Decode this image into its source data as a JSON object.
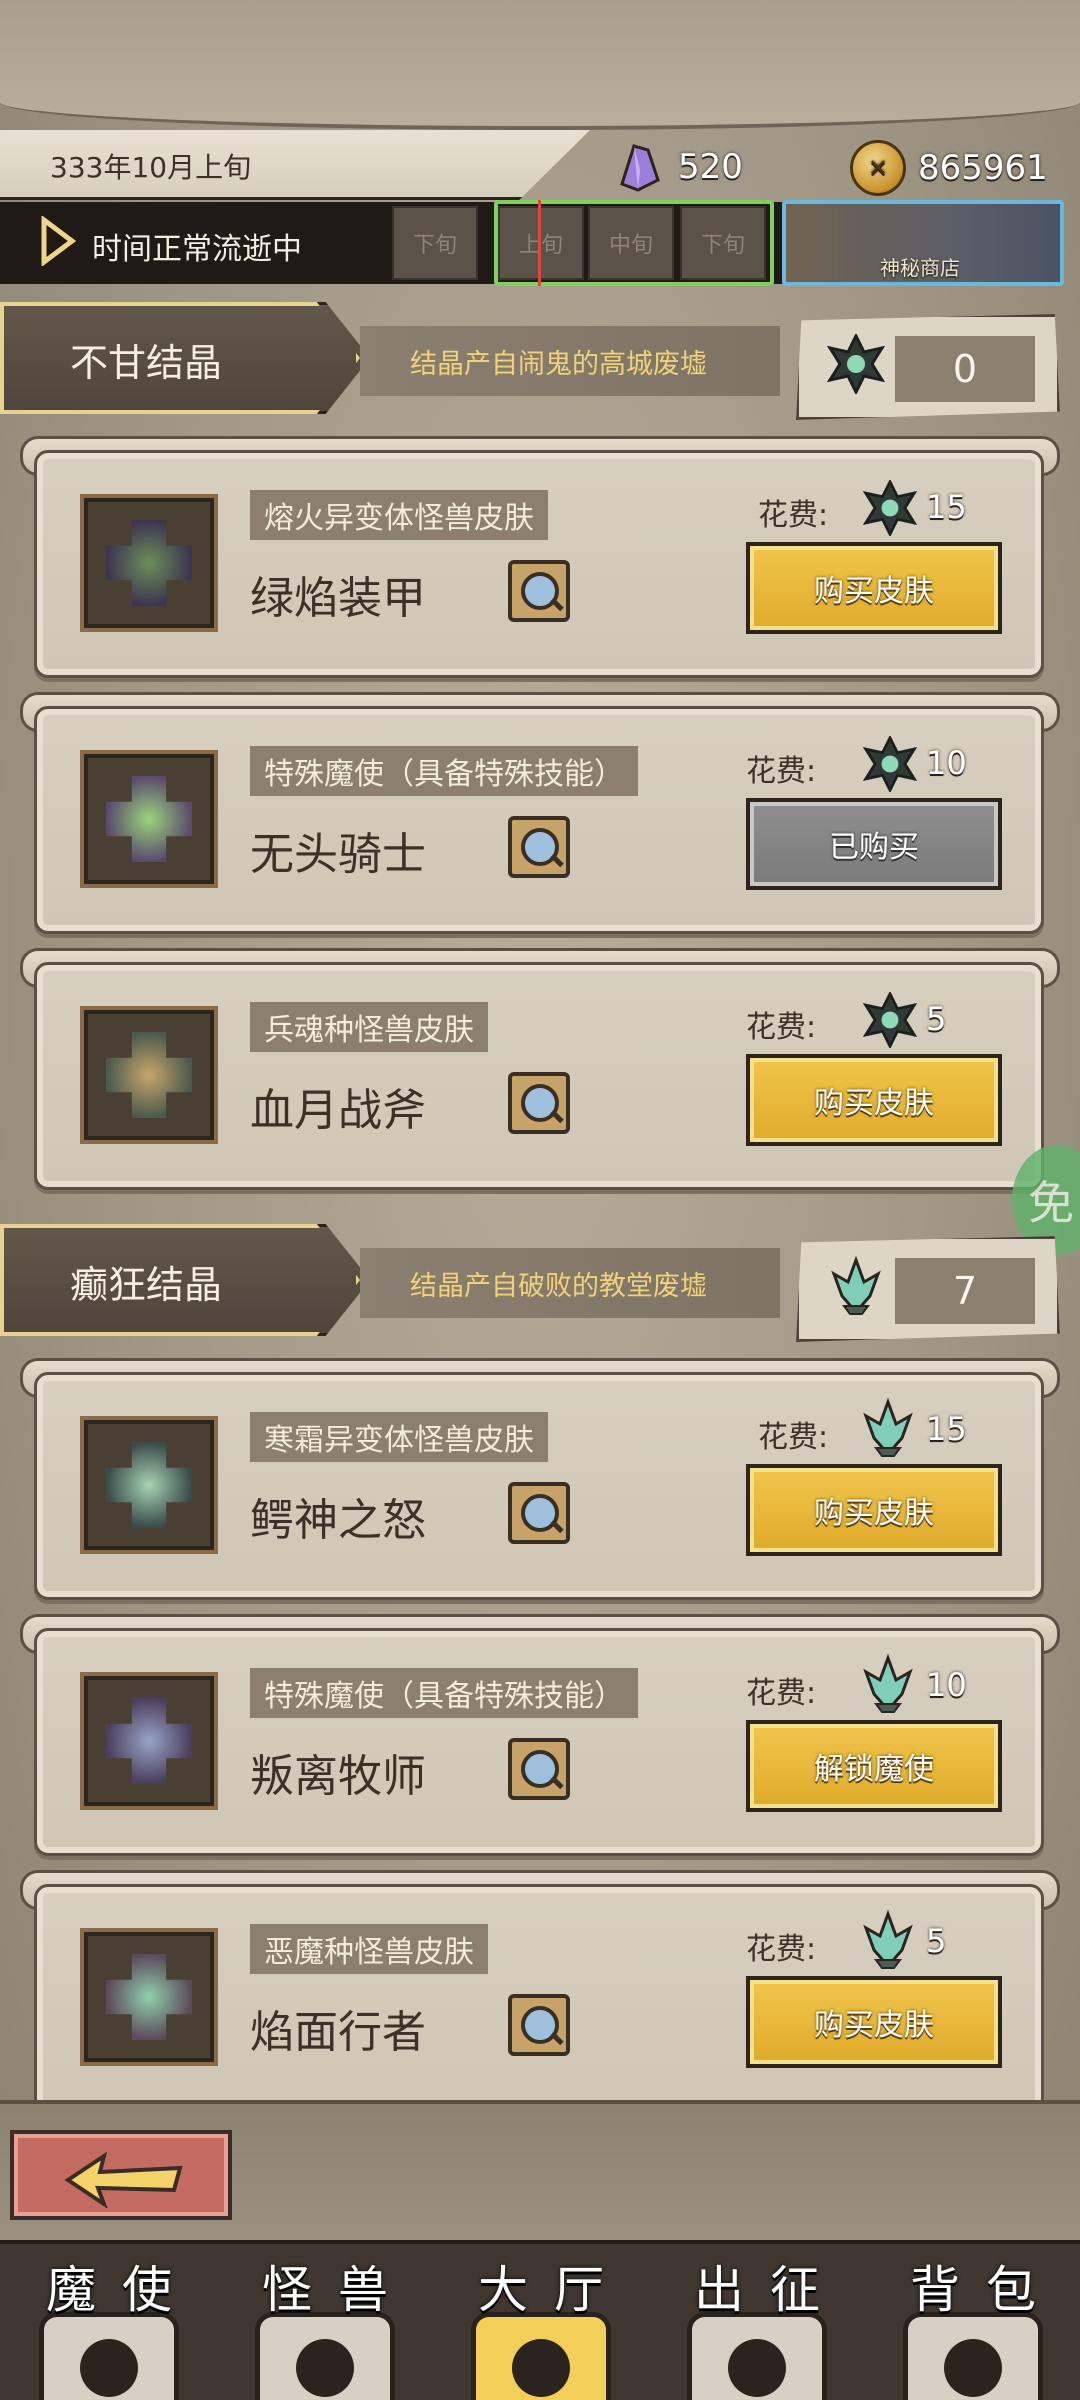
{
  "header": {
    "date": "333年10月上旬",
    "gems": "520",
    "gold": "865961",
    "time_status": "时间正常流逝中",
    "periods": [
      "下旬",
      "上旬",
      "中旬",
      "下旬"
    ],
    "shop_label": "神秘商店"
  },
  "sections": [
    {
      "title": "不甘结晶",
      "subtitle": "结晶产自闹鬼的高城废墟",
      "count": "0",
      "currency_icon": "dark-crystal-icon",
      "items": [
        {
          "type": "熔火异变体怪兽皮肤",
          "name": "绿焰装甲",
          "cost_label": "花费:",
          "cost": "15",
          "button": "购买皮肤",
          "state": "available"
        },
        {
          "type": "特殊魔使（具备特殊技能）",
          "name": "无头骑士",
          "cost_label": "花费:",
          "cost": "10",
          "button": "已购买",
          "state": "bought"
        },
        {
          "type": "兵魂种怪兽皮肤",
          "name": "血月战斧",
          "cost_label": "花费:",
          "cost": "5",
          "button": "购买皮肤",
          "state": "available"
        }
      ]
    },
    {
      "title": "癫狂结晶",
      "subtitle": "结晶产自破败的教堂废墟",
      "count": "7",
      "currency_icon": "frost-crystal-icon",
      "items": [
        {
          "type": "寒霜异变体怪兽皮肤",
          "name": "鳄神之怒",
          "cost_label": "花费:",
          "cost": "15",
          "button": "购买皮肤",
          "state": "available"
        },
        {
          "type": "特殊魔使（具备特殊技能）",
          "name": "叛离牧师",
          "cost_label": "花费:",
          "cost": "10",
          "button": "解锁魔使",
          "state": "available"
        },
        {
          "type": "恶魔种怪兽皮肤",
          "name": "焰面行者",
          "cost_label": "花费:",
          "cost": "5",
          "button": "购买皮肤",
          "state": "available"
        }
      ]
    }
  ],
  "side_badge": "免",
  "nav": [
    {
      "label": "魔使"
    },
    {
      "label": "怪兽"
    },
    {
      "label": "大厅"
    },
    {
      "label": "出征"
    },
    {
      "label": "背包"
    }
  ],
  "colors": {
    "accent_gold": "#f0c64b",
    "period_highlight": "#7fd05c",
    "shop_border": "#6ab8de",
    "back_button": "#c46c62"
  }
}
